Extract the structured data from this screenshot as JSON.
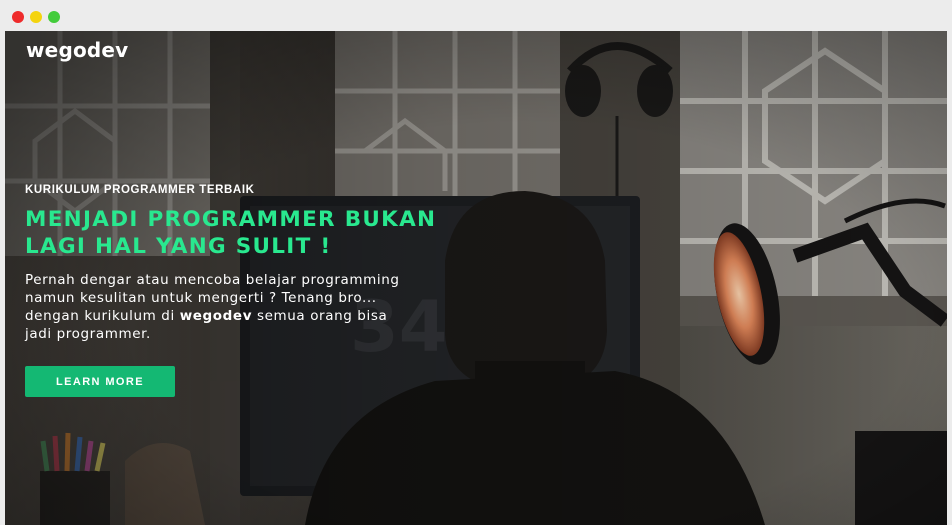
{
  "browser": {
    "controls": [
      "close",
      "minimize",
      "maximize"
    ],
    "colors": {
      "close": "#ee2b2b",
      "minimize": "#f4d40e",
      "maximize": "#43cc3b"
    }
  },
  "nav": {
    "brand": "wegodev"
  },
  "hero": {
    "eyebrow": "KURIKULUM PROGRAMMER TERBAIK",
    "headline_line1": "MENJADI PROGRAMMER BUKAN",
    "headline_line2": "LAGI HAL YANG SULIT !",
    "lead_line1": "Pernah dengar atau mencoba belajar programming",
    "lead_line2": "namun kesulitan untuk mengerti ? Tenang bro...",
    "lead_line3_pre": "dengan kurikulum di ",
    "lead_line3_bold": "wegodev",
    "lead_line3_post": " semua orang bisa",
    "lead_line4": "jadi programmer.",
    "cta_label": "LEARN MORE",
    "accent_color": "#29e88f",
    "button_color": "#14b873"
  },
  "background_photo": {
    "subject": "person-at-desk-with-monitor-lamp-headphones",
    "monitor_text": "34"
  }
}
